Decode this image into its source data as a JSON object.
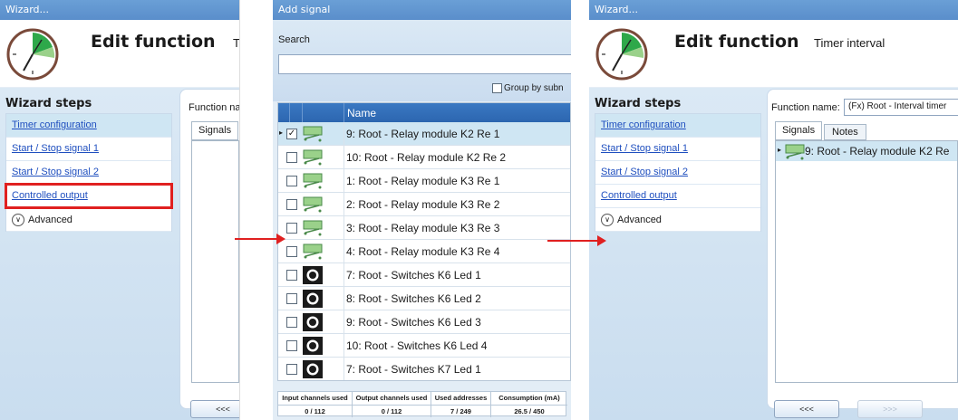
{
  "left_panel": {
    "window_title": "Wizard...",
    "header_title": "Edit function",
    "header_subtitle": "T",
    "steps_title": "Wizard steps",
    "steps": [
      "Timer configuration",
      "Start / Stop signal 1",
      "Start / Stop signal 2",
      "Controlled output"
    ],
    "advanced_label": "Advanced",
    "function_name_label": "Function na",
    "signals_tab": "Signals",
    "back_button": "<<<"
  },
  "add_signal": {
    "window_title": "Add signal",
    "search_label": "Search",
    "search_value": "",
    "group_by_label": "Group by subn",
    "column_name": "Name",
    "rows": [
      {
        "label": "9: Root - Relay module K2 Re 1",
        "checked": true,
        "icon": "relay-icon",
        "selected": true
      },
      {
        "label": "10: Root - Relay module K2 Re 2",
        "checked": false,
        "icon": "relay-icon",
        "selected": false
      },
      {
        "label": "1: Root - Relay module K3 Re 1",
        "checked": false,
        "icon": "relay-icon",
        "selected": false
      },
      {
        "label": "2: Root - Relay module K3 Re 2",
        "checked": false,
        "icon": "relay-icon",
        "selected": false
      },
      {
        "label": "3: Root - Relay module K3 Re 3",
        "checked": false,
        "icon": "relay-icon",
        "selected": false
      },
      {
        "label": "4: Root - Relay module K3 Re 4",
        "checked": false,
        "icon": "relay-icon",
        "selected": false
      },
      {
        "label": "7: Root - Switches K6 Led 1",
        "checked": false,
        "icon": "switch-led-icon",
        "selected": false
      },
      {
        "label": "8: Root - Switches K6 Led 2",
        "checked": false,
        "icon": "switch-led-icon",
        "selected": false
      },
      {
        "label": "9: Root - Switches K6 Led 3",
        "checked": false,
        "icon": "switch-led-icon",
        "selected": false
      },
      {
        "label": "10: Root - Switches K6 Led 4",
        "checked": false,
        "icon": "switch-led-icon",
        "selected": false
      },
      {
        "label": "7: Root - Switches K7 Led 1",
        "checked": false,
        "icon": "switch-led-icon",
        "selected": false
      }
    ],
    "stats": [
      {
        "header": "Input channels used",
        "value": "0 / 112"
      },
      {
        "header": "Output channels used",
        "value": "0 / 112"
      },
      {
        "header": "Used addresses",
        "value": "7 / 249"
      },
      {
        "header": "Consumption (mA)",
        "value": "26.5 / 450"
      }
    ]
  },
  "right_panel": {
    "window_title": "Wizard...",
    "header_title": "Edit function",
    "header_subtitle": "Timer interval",
    "steps_title": "Wizard steps",
    "steps": [
      "Timer configuration",
      "Start / Stop signal 1",
      "Start / Stop signal 2",
      "Controlled output"
    ],
    "advanced_label": "Advanced",
    "function_name_label": "Function name:",
    "function_name_value": "(Fx) Root - Interval timer",
    "signals_tab": "Signals",
    "notes_tab": "Notes",
    "signal_item": "9: Root - Relay module K2 Re",
    "back_button": "<<<",
    "next_button": ">>>"
  },
  "colors": {
    "accent": "#e02020",
    "titlebar": "#5a8ecb",
    "selection": "#cfe6f3",
    "link": "#1f4fbf"
  }
}
